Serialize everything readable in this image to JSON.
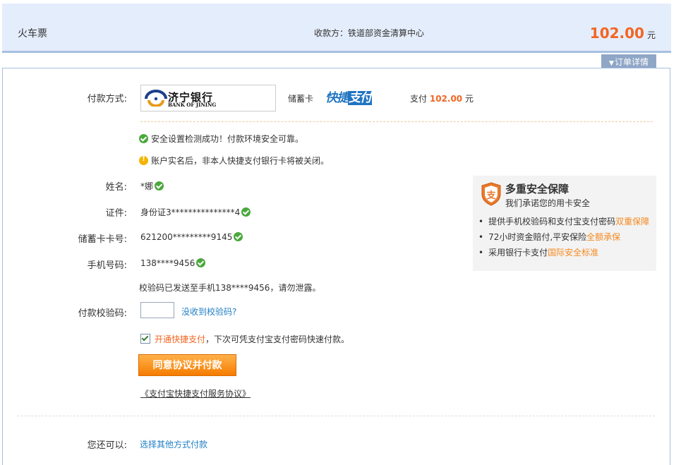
{
  "header": {
    "title": "火车票",
    "payee": "收款方：铁道部资金清算中心",
    "amount": "102.00",
    "currency": "元"
  },
  "order_detail_tab": "订单详情",
  "payment": {
    "method_label": "付款方式:",
    "bank": {
      "name_zh": "济宁银行",
      "name_en": "BANK OF JINING"
    },
    "card_type": "储蓄卡",
    "quickpay_part1": "快捷",
    "quickpay_part2": "支付",
    "pay_prefix": "支付",
    "pay_amount": "102.00",
    "pay_unit": "元"
  },
  "notices": {
    "security_ok": "安全设置检测成功！付款环境安全可靠。",
    "realname_warn": "账户实名后，非本人快捷支付银行卡将被关闭。"
  },
  "fields": {
    "name_label": "姓名:",
    "name_value": "*娜",
    "id_label": "证件:",
    "id_value": "身份证3***************4",
    "card_label": "储蓄卡卡号:",
    "card_value": "621200*********9145",
    "phone_label": "手机号码:",
    "phone_value": "138****9456"
  },
  "verify": {
    "sent_note": "校验码已发送至手机138****9456，请勿泄露。",
    "label": "付款校验码:",
    "input_value": "",
    "not_received_link": "没收到校验码?"
  },
  "agree": {
    "checked": true,
    "highlight": "开通快捷支付",
    "rest": "，下次可凭支付宝支付密码快速付款。"
  },
  "pay_button": "同意协议并付款",
  "protocol_link": "《支付宝快捷支付服务协议》",
  "alternative": {
    "label": "您还可以:",
    "link": "选择其他方式付款"
  },
  "security_box": {
    "title": "多重安全保障",
    "subtitle": "我们承诺您的用卡安全",
    "items": [
      {
        "text": "提供手机校验码和支付宝支付密码",
        "highlight": "双重保障"
      },
      {
        "text": "72小时资金赔付,平安保险",
        "highlight": "全额承保"
      },
      {
        "text": "采用银行卡支付",
        "highlight": "国际安全标准"
      }
    ]
  },
  "colors": {
    "accent_orange": "#f26522",
    "link_blue": "#1f7fc6",
    "header_bg": "#e4edfb",
    "success_green": "#4aa83c"
  }
}
